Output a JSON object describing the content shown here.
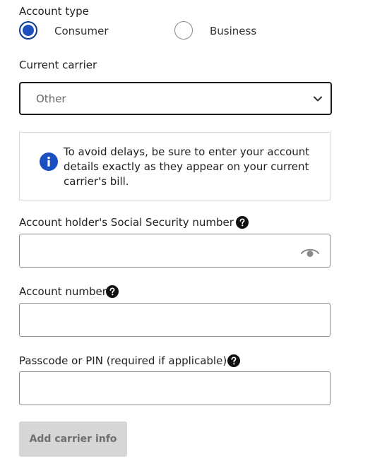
{
  "account_type": {
    "label": "Account type",
    "options": [
      {
        "label": "Consumer",
        "selected": true
      },
      {
        "label": "Business",
        "selected": false
      }
    ]
  },
  "current_carrier": {
    "label": "Current carrier",
    "selected_value": "Other"
  },
  "info_notice": {
    "text": "To avoid delays, be sure to enter your account details exactly as they appear on your current carrier's bill.",
    "icon": "info-icon"
  },
  "ssn_field": {
    "label": "Account holder's Social Security number",
    "value": "",
    "icon": "eye-icon"
  },
  "account_number_field": {
    "label": "Account number",
    "value": ""
  },
  "passcode_field": {
    "label": "Passcode or PIN (required if applicable)",
    "value": ""
  },
  "submit": {
    "label": "Add carrier info",
    "disabled": true
  },
  "colors": {
    "radio_selected": "#1f4fbf",
    "info_icon": "#1a4fc2",
    "button_disabled_bg": "#d6d6d6",
    "button_disabled_text": "#6e6e6e"
  }
}
